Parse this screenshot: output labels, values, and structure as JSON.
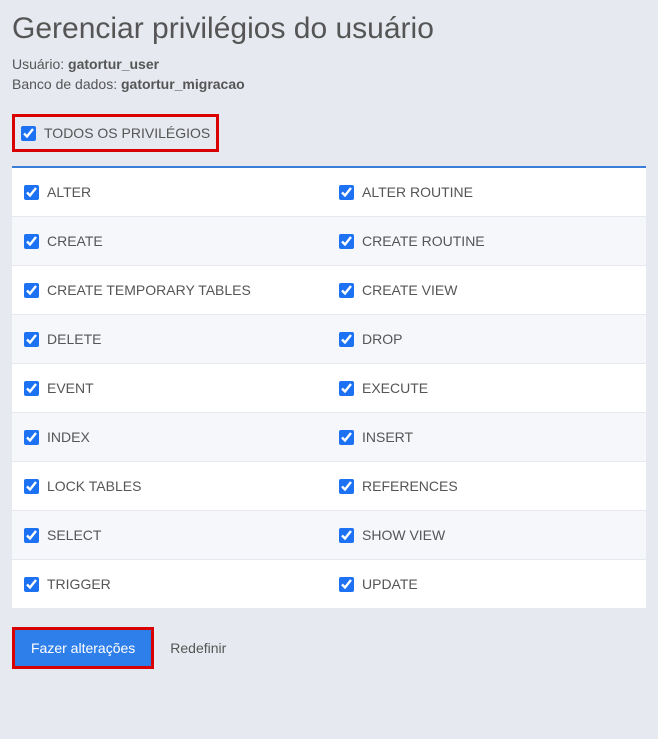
{
  "header": {
    "title": "Gerenciar privilégios do usuário",
    "user_label": "Usuário:",
    "user_value": "gatortur_user",
    "db_label": "Banco de dados:",
    "db_value": "gatortur_migracao"
  },
  "all_privileges": {
    "label": "TODOS OS PRIVILÉGIOS",
    "checked": true
  },
  "privileges": [
    {
      "left": "ALTER",
      "right": "ALTER ROUTINE"
    },
    {
      "left": "CREATE",
      "right": "CREATE ROUTINE"
    },
    {
      "left": "CREATE TEMPORARY TABLES",
      "right": "CREATE VIEW"
    },
    {
      "left": "DELETE",
      "right": "DROP"
    },
    {
      "left": "EVENT",
      "right": "EXECUTE"
    },
    {
      "left": "INDEX",
      "right": "INSERT"
    },
    {
      "left": "LOCK TABLES",
      "right": "REFERENCES"
    },
    {
      "left": "SELECT",
      "right": "SHOW VIEW"
    },
    {
      "left": "TRIGGER",
      "right": "UPDATE"
    }
  ],
  "actions": {
    "save": "Fazer alterações",
    "reset": "Redefinir"
  }
}
